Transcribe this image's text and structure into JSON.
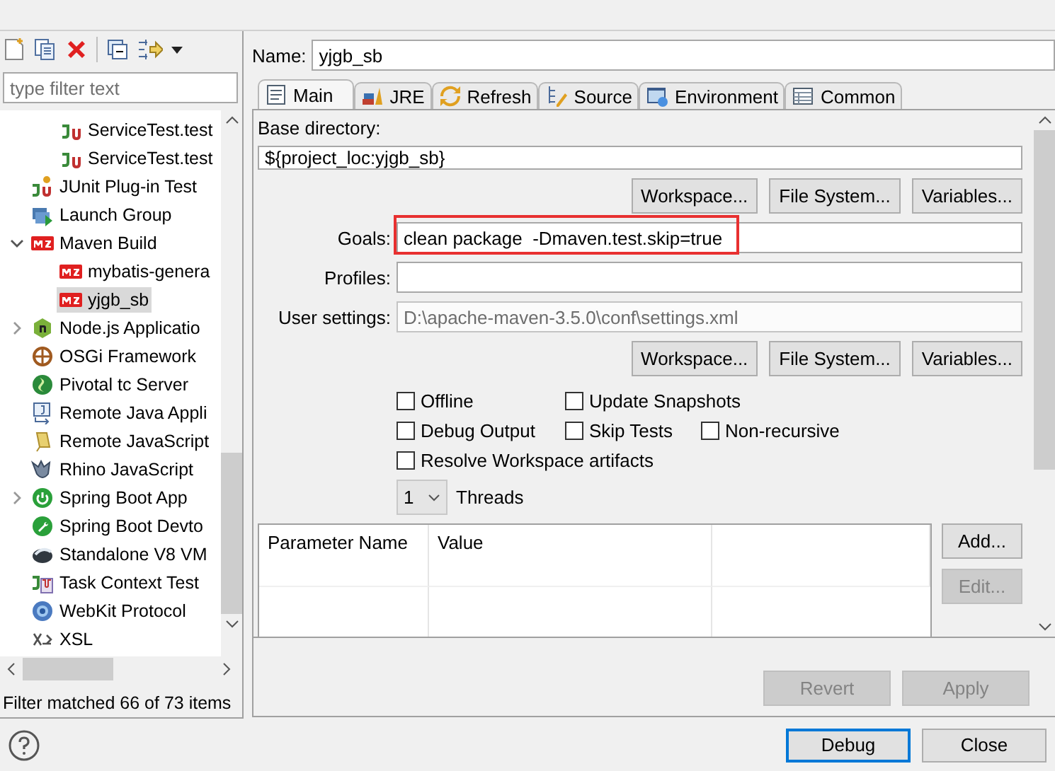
{
  "sidebar": {
    "filter": {
      "placeholder": "type filter text"
    },
    "tree": {
      "hidden_parent_children": [
        {
          "label": "ServiceTest.test",
          "kind": "junit",
          "selected": false
        },
        {
          "label": "ServiceTest.test",
          "kind": "junit",
          "selected": false
        }
      ],
      "items": [
        {
          "label": "JUnit Plug-in Test",
          "kind": "junit-plugin",
          "selected": false
        },
        {
          "label": "Launch Group",
          "kind": "group",
          "selected": false
        },
        {
          "label": "Maven Build",
          "kind": "m2",
          "selected": false,
          "expanded": true,
          "children": [
            {
              "label": "mybatis-genera",
              "kind": "m2",
              "selected": false
            },
            {
              "label": "yjgb_sb",
              "kind": "m2",
              "selected": true
            }
          ]
        },
        {
          "label": "Node.js Applicatio",
          "kind": "node",
          "selected": false,
          "expanded": false
        },
        {
          "label": "OSGi Framework",
          "kind": "osgi",
          "selected": false
        },
        {
          "label": "Pivotal tc Server",
          "kind": "pivotal",
          "selected": false
        },
        {
          "label": "Remote Java Appli",
          "kind": "remote-java",
          "selected": false
        },
        {
          "label": "Remote JavaScript",
          "kind": "remote-js",
          "selected": false
        },
        {
          "label": "Rhino JavaScript",
          "kind": "rhino",
          "selected": false
        },
        {
          "label": "Spring Boot App",
          "kind": "spring",
          "selected": false,
          "expanded": false
        },
        {
          "label": "Spring Boot Devto",
          "kind": "spring-devtools",
          "selected": false
        },
        {
          "label": "Standalone V8 VM",
          "kind": "v8",
          "selected": false
        },
        {
          "label": "Task Context Test",
          "kind": "task",
          "selected": false
        },
        {
          "label": "WebKit Protocol",
          "kind": "webkit",
          "selected": false
        },
        {
          "label": "XSL",
          "kind": "xsl",
          "selected": false
        }
      ]
    },
    "status": "Filter matched 66 of 73 items"
  },
  "name": {
    "label": "Name:",
    "value": "yjgb_sb"
  },
  "tabs": [
    {
      "label": "Main",
      "kind": "main",
      "selected": true
    },
    {
      "label": "JRE",
      "kind": "jre",
      "selected": false
    },
    {
      "label": "Refresh",
      "kind": "refresh",
      "selected": false
    },
    {
      "label": "Source",
      "kind": "source",
      "selected": false
    },
    {
      "label": "Environment",
      "kind": "environment",
      "selected": false
    },
    {
      "label": "Common",
      "kind": "common",
      "selected": false
    }
  ],
  "main": {
    "base_directory": {
      "label": "Base directory:",
      "value": "${project_loc:yjgb_sb}"
    },
    "directory_buttons": [
      "Workspace...",
      "File System...",
      "Variables..."
    ],
    "fields": [
      {
        "label": "Goals:",
        "value": "clean package  -Dmaven.test.skip=true",
        "disabled": false,
        "highlighted": true
      },
      {
        "label": "Profiles:",
        "disabled": false,
        "highlighted": false
      },
      {
        "label": "User settings:",
        "value": "D:\\apache-maven-3.5.0\\conf\\settings.xml",
        "disabled": true,
        "highlighted": false
      }
    ],
    "settings_buttons": [
      "Workspace...",
      "File System...",
      "Variables..."
    ],
    "option_rows": [
      {
        "options": [
          {
            "label": "Offline",
            "checked": false
          },
          {
            "label": "Update Snapshots",
            "checked": false
          }
        ]
      },
      {
        "options": [
          {
            "label": "Debug Output",
            "checked": false
          },
          {
            "label": "Skip Tests",
            "checked": false
          },
          {
            "label": "Non-recursive",
            "checked": false
          }
        ]
      },
      {
        "options": [
          {
            "label": "Resolve Workspace artifacts",
            "checked": false
          }
        ]
      }
    ],
    "threads": {
      "value": "1",
      "label": "Threads"
    },
    "parameters": {
      "columns": [
        "Parameter Name",
        "Value"
      ],
      "buttons": [
        {
          "label": "Add...",
          "disabled": false
        },
        {
          "label": "Edit...",
          "disabled": true
        }
      ]
    },
    "actions": [
      {
        "label": "Revert",
        "disabled": true
      },
      {
        "label": "Apply",
        "disabled": true
      }
    ]
  },
  "dialog_buttons": [
    {
      "label": "Debug",
      "default": true
    },
    {
      "label": "Close",
      "default": false
    }
  ]
}
